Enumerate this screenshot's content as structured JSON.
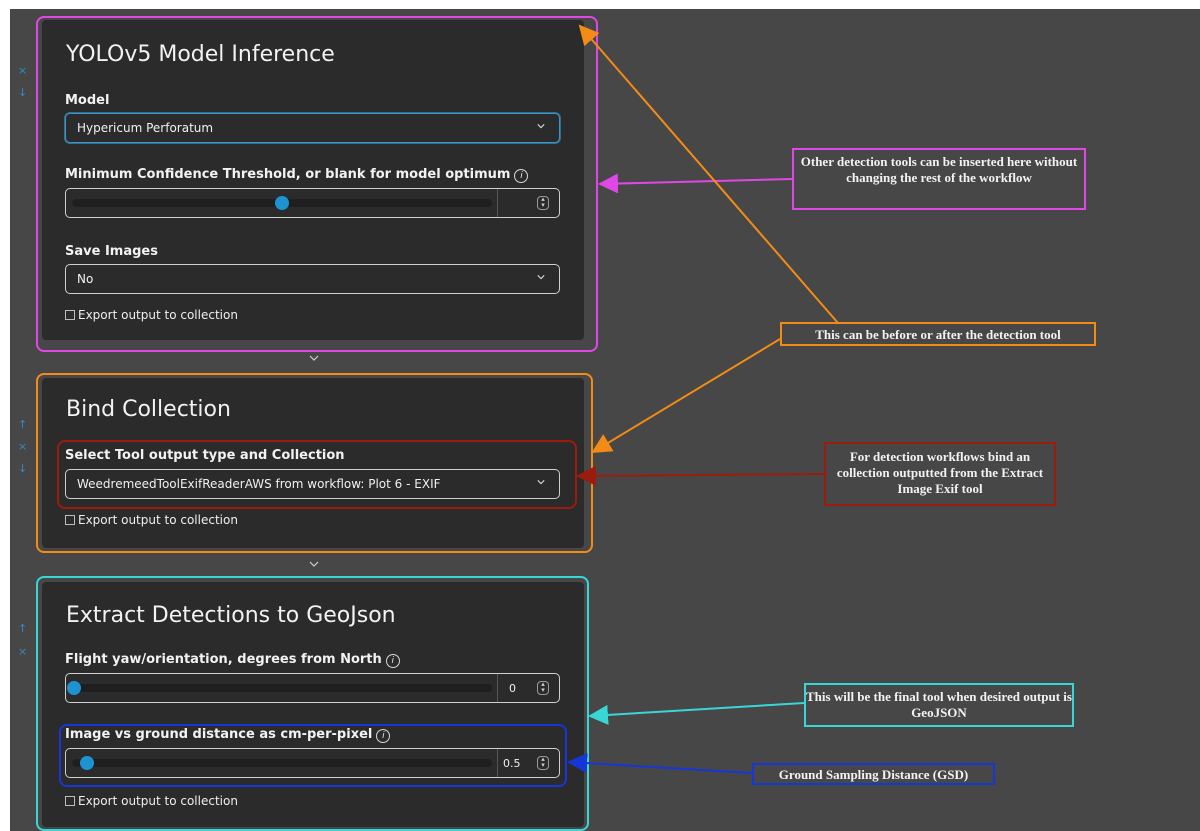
{
  "controls": {
    "move_up": "↑",
    "remove": "×",
    "move_down": "↓",
    "collapse": "⌄",
    "spin_up": "▴",
    "spin_down": "▾",
    "info": "i"
  },
  "yolo_card": {
    "title": "YOLOv5 Model Inference",
    "model_label": "Model",
    "model_value": "Hypericum Perforatum",
    "confidence_label": "Minimum Confidence Threshold, or blank for model optimum",
    "confidence_level": 0.5,
    "save_images_label": "Save Images",
    "save_images_value": "No",
    "export_label": "Export output to collection"
  },
  "bind_card": {
    "title": "Bind Collection",
    "select_label": "Select Tool output type and Collection",
    "select_value": "WeedremeedToolExifReaderAWS from workflow: Plot 6 - EXIF",
    "export_label": "Export output to collection"
  },
  "geojson_card": {
    "title": "Extract Detections to GeoJson",
    "yaw_label": "Flight yaw/orientation, degrees from North",
    "yaw_value": "0",
    "gsd_label": "Image vs ground distance as cm-per-pixel",
    "gsd_value": "0.5",
    "export_label": "Export output to collection"
  },
  "annotations": {
    "detection_tools": "Other detection tools can be inserted here without changing the rest of the workflow",
    "before_after": "This can be before or after the detection tool",
    "bind_exif": "For detection workflows bind an collection outputted from the Extract Image Exif tool",
    "final_tool": "This will be the final tool when desired output is GeoJSON",
    "gsd": "Ground Sampling Distance (GSD)"
  },
  "colors": {
    "magenta": "#e048e6",
    "orange": "#f28c16",
    "dark_red": "#9b1c0c",
    "cyan": "#39d6d6",
    "blue": "#1636d8",
    "accent": "#1e93d1"
  }
}
